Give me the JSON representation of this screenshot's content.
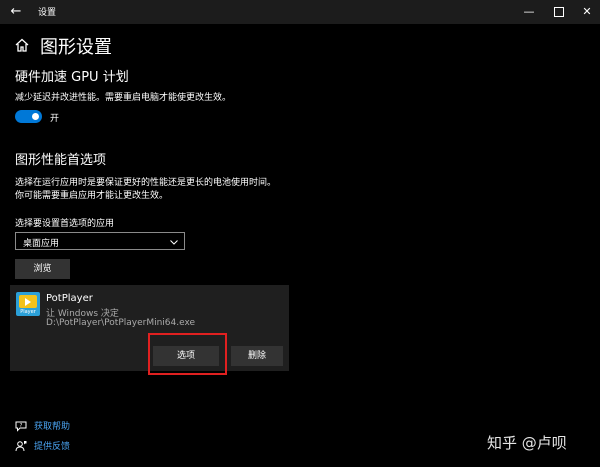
{
  "window": {
    "title": "设置",
    "back_glyph": "←",
    "min_glyph": "—",
    "close_glyph": "✕"
  },
  "header": {
    "title": "图形设置",
    "icon": "home-icon"
  },
  "gpu_scheduling": {
    "heading": "硬件加速 GPU 计划",
    "description": "减少延迟并改进性能。需要重启电脑才能使更改生效。",
    "toggle_state": "开",
    "toggle_on": true,
    "accent_color": "#0078d7"
  },
  "preference": {
    "heading": "图形性能首选项",
    "description_line1": "选择在运行应用时是要保证更好的性能还是更长的电池使用时间。",
    "description_line2": "你可能需要重启应用才能让更改生效。",
    "select_label": "选择要设置首选项的应用",
    "selected_app_type": "桌面应用",
    "browse_label": "浏览"
  },
  "app_entry": {
    "name": "PotPlayer",
    "preference": "让 Windows 决定",
    "path": "D:\\PotPlayer\\PotPlayerMini64.exe",
    "icon_label": "Player",
    "options_label": "选项",
    "delete_label": "删除"
  },
  "footer": {
    "help_label": "获取帮助",
    "feedback_label": "提供反馈",
    "link_color": "#4aa3f0"
  },
  "watermark": "知乎 @卢呗",
  "highlight_color": "#e02020"
}
